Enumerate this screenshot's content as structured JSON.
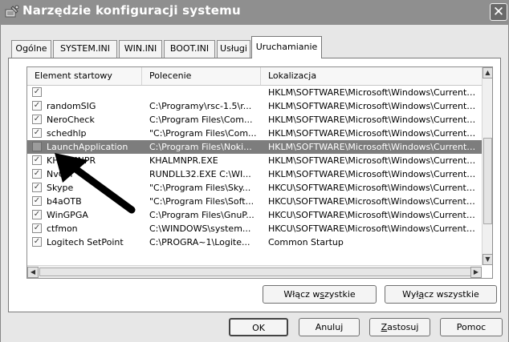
{
  "window": {
    "title": "Narzędzie konfiguracji systemu",
    "close_glyph": "✕"
  },
  "tabs": [
    {
      "label": "Ogólne"
    },
    {
      "label": "SYSTEM.INI"
    },
    {
      "label": "WIN.INI"
    },
    {
      "label": "BOOT.INI"
    },
    {
      "label": "Usługi"
    },
    {
      "label": "Uruchamianie"
    }
  ],
  "active_tab": "Uruchamianie",
  "list": {
    "columns": [
      "Element startowy",
      "Polecenie",
      "Lokalizacja"
    ],
    "rows": [
      {
        "name": "",
        "command": "",
        "location": "HKLM\\SOFTWARE\\Microsoft\\Windows\\CurrentVer...",
        "checked": true
      },
      {
        "name": "randomSIG",
        "command": "C:\\Programy\\rsc-1.5\\r...",
        "location": "HKLM\\SOFTWARE\\Microsoft\\Windows\\CurrentVer...",
        "checked": true
      },
      {
        "name": "NeroCheck",
        "command": "C:\\Program Files\\Com...",
        "location": "HKLM\\SOFTWARE\\Microsoft\\Windows\\CurrentVer...",
        "checked": true
      },
      {
        "name": "schedhlp",
        "command": "\"C:\\Program Files\\Com...",
        "location": "HKLM\\SOFTWARE\\Microsoft\\Windows\\CurrentVer...",
        "checked": true
      },
      {
        "name": "LaunchApplication",
        "command": "C:\\Program Files\\Noki...",
        "location": "HKLM\\SOFTWARE\\Microsoft\\Windows\\CurrentVer...",
        "checked": false,
        "selected": true
      },
      {
        "name": "KHALMNPR",
        "command": "KHALMNPR.EXE",
        "location": "HKLM\\SOFTWARE\\Microsoft\\Windows\\CurrentVer...",
        "checked": true
      },
      {
        "name": "NvCpl",
        "command": "RUNDLL32.EXE C:\\WI...",
        "location": "HKLM\\SOFTWARE\\Microsoft\\Windows\\CurrentVer...",
        "checked": true
      },
      {
        "name": "Skype",
        "command": "\"C:\\Program Files\\Sky...",
        "location": "HKCU\\SOFTWARE\\Microsoft\\Windows\\CurrentVer...",
        "checked": true
      },
      {
        "name": "b4aOTB",
        "command": "\"C:\\Program Files\\Soft...",
        "location": "HKCU\\SOFTWARE\\Microsoft\\Windows\\CurrentVer...",
        "checked": true
      },
      {
        "name": "WinGPGA",
        "command": "C:\\Program Files\\GnuP...",
        "location": "HKCU\\SOFTWARE\\Microsoft\\Windows\\CurrentVer...",
        "checked": true
      },
      {
        "name": "ctfmon",
        "command": "C:\\WINDOWS\\system...",
        "location": "HKCU\\SOFTWARE\\Microsoft\\Windows\\CurrentVer...",
        "checked": true
      },
      {
        "name": "Logitech SetPoint",
        "command": "C:\\PROGRA~1\\Logite...",
        "location": "Common Startup",
        "checked": true
      }
    ]
  },
  "buttons": {
    "enable_all": {
      "before": "Włącz w",
      "mnemonic": "s",
      "after": "zystkie"
    },
    "disable_all": {
      "before": "Wył",
      "mnemonic": "ą",
      "after": "cz wszystkie"
    },
    "ok": {
      "before": "",
      "mnemonic": "",
      "after": "OK"
    },
    "cancel": {
      "before": "Anuluj",
      "mnemonic": "",
      "after": ""
    },
    "apply": {
      "before": "",
      "mnemonic": "Z",
      "after": "astosuj"
    },
    "help": {
      "before": "Pomoc",
      "mnemonic": "",
      "after": ""
    }
  },
  "icons": {
    "title": "system-config-icon",
    "checkbox_checked": "✓",
    "scroll_up": "▲",
    "scroll_down": "▼",
    "scroll_left": "◀",
    "scroll_right": "▶"
  },
  "colors": {
    "titlebar": "#8f8f8f",
    "selection": "#7d7d7d",
    "dialog_bg": "#e7e7e7"
  }
}
